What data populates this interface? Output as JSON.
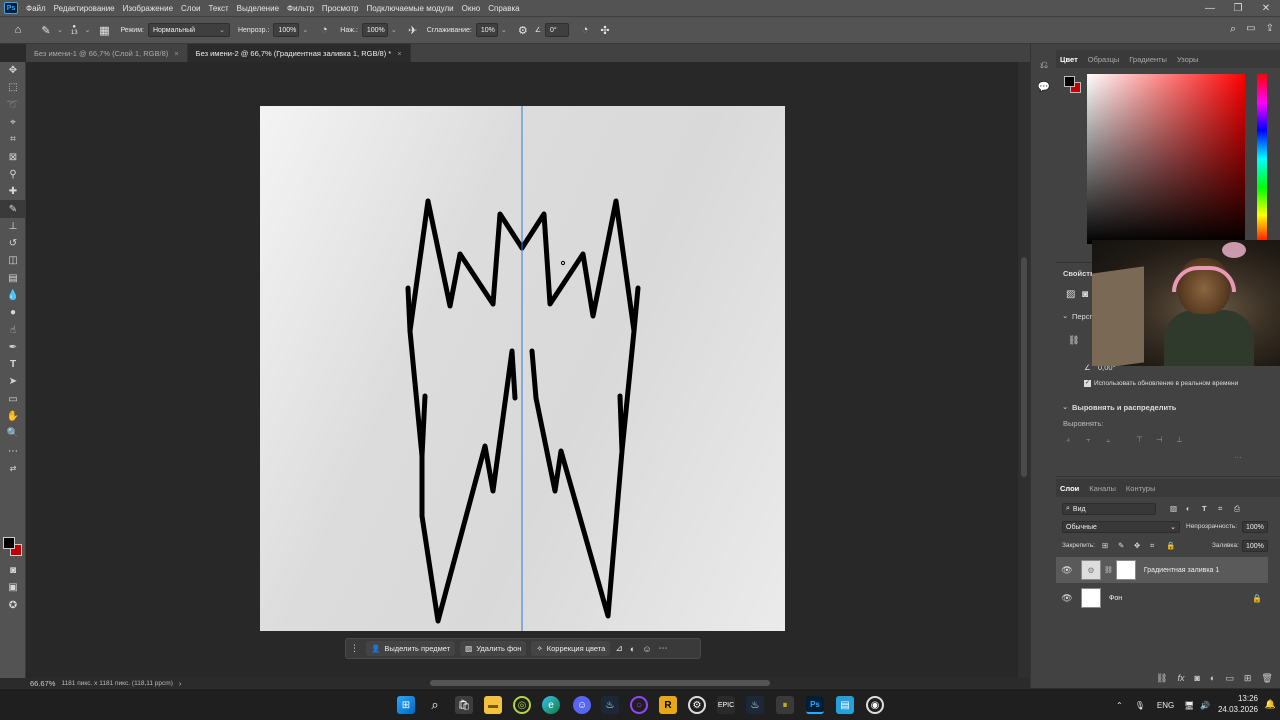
{
  "menubar": {
    "logo": "Ps",
    "items": [
      "Файл",
      "Редактирование",
      "Изображение",
      "Слои",
      "Текст",
      "Выделение",
      "Фильтр",
      "Просмотр",
      "Подключаемые модули",
      "Окно",
      "Справка"
    ],
    "window_controls": [
      "—",
      "❐",
      "✕"
    ]
  },
  "optbar": {
    "brush_size": "13",
    "mode_label": "Режим:",
    "mode_value": "Нормальный",
    "opacity_label": "Непрозр.:",
    "opacity_value": "100%",
    "pressure_label": "Наж.:",
    "pressure_value": "100%",
    "smoothing_label": "Сглаживание:",
    "smoothing_value": "10%",
    "angle_value": "0°"
  },
  "tabs": [
    {
      "label": "Без имени-1 @ 66,7% (Слой 1, RGB/8)",
      "active": false
    },
    {
      "label": "Без имени-2 @ 66,7% (Градиентная заливка 1, RGB/8) *",
      "active": true
    }
  ],
  "ctxbar": {
    "select_subject": "Выделить предмет",
    "remove_bg": "Удалить фон",
    "color_correction": "Коррекция цвета"
  },
  "status": {
    "zoom": "66.67%",
    "size": "1181 пикс. x 1181 пикс. (118,11 ppcm)"
  },
  "color_panel": {
    "tabs": [
      "Цвет",
      "Образцы",
      "Градиенты",
      "Узоры"
    ],
    "fg_color": "#000000",
    "bg_color": "#c00000"
  },
  "props_panel": {
    "title": "Свойства",
    "perspective_label": "Перспе",
    "angle_value": "0,00°",
    "realtime_update": "Использовать обновление в реальном времени",
    "align_title": "Выровнять и распределить",
    "align_label": "Выровнять:"
  },
  "layers_panel": {
    "tabs": [
      "Слои",
      "Каналы",
      "Контуры"
    ],
    "filter_kind": "Вид",
    "blend_mode": "Обычные",
    "opacity_label": "Непрозрачность:",
    "opacity_value": "100%",
    "lock_label": "Закрепить:",
    "fill_label": "Заливка:",
    "fill_value": "100%",
    "layers": [
      {
        "name": "Градиентная заливка 1",
        "selected": true
      },
      {
        "name": "Фон",
        "selected": false
      }
    ]
  },
  "taskbar": {
    "lang": "ENG",
    "time": "13:26",
    "date": "24.03.2026"
  }
}
